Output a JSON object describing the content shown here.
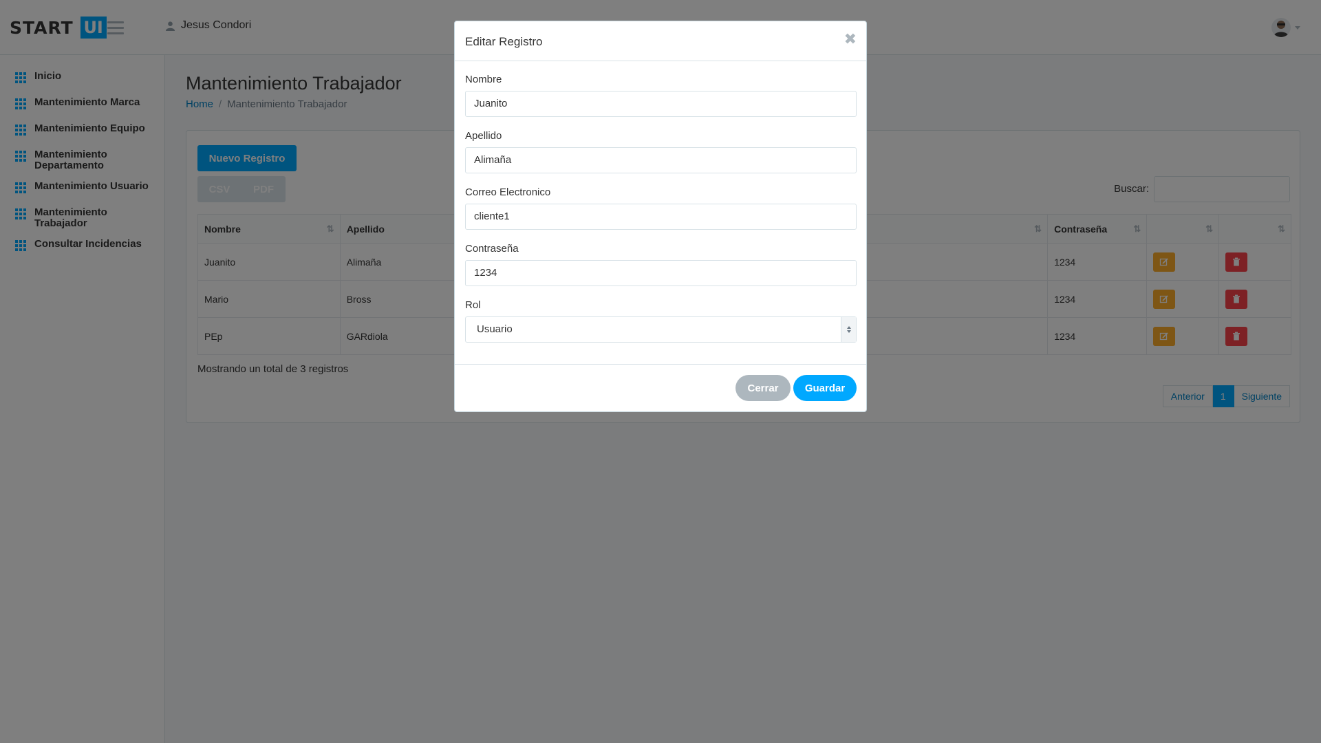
{
  "header": {
    "logo_start": "START",
    "logo_ui": "UI",
    "user_name": "Jesus Condori"
  },
  "sidebar": {
    "items": [
      {
        "label": "Inicio"
      },
      {
        "label": "Mantenimiento Marca"
      },
      {
        "label": "Mantenimiento Equipo"
      },
      {
        "label": "Mantenimiento Departamento"
      },
      {
        "label": "Mantenimiento Usuario"
      },
      {
        "label": "Mantenimiento Trabajador"
      },
      {
        "label": "Consultar Incidencias"
      }
    ]
  },
  "page": {
    "title": "Mantenimiento Trabajador",
    "breadcrumb_home": "Home",
    "breadcrumb_sep": "/",
    "breadcrumb_current": "Mantenimiento Trabajador"
  },
  "toolbar": {
    "new_label": "Nuevo Registro",
    "csv_label": "CSV",
    "pdf_label": "PDF",
    "search_label": "Buscar:"
  },
  "table": {
    "headers": [
      "Nombre",
      "Apellido",
      "",
      "Contraseña",
      "",
      ""
    ],
    "rows": [
      {
        "nombre": "Juanito",
        "apellido": "Alimaña",
        "contrasena": "1234"
      },
      {
        "nombre": "Mario",
        "apellido": "Bross",
        "contrasena": "1234"
      },
      {
        "nombre": "PEp",
        "apellido": "GARdiola",
        "contrasena": "1234"
      }
    ]
  },
  "footer": {
    "total_text": "Mostrando un total de 3 registros",
    "prev_label": "Anterior",
    "page_label": "1",
    "next_label": "Siguiente"
  },
  "modal": {
    "title": "Editar Registro",
    "close_glyph": "✖",
    "fields": {
      "nombre": {
        "label": "Nombre",
        "value": "Juanito"
      },
      "apellido": {
        "label": "Apellido",
        "value": "Alimaña"
      },
      "correo": {
        "label": "Correo Electronico",
        "value": "cliente1"
      },
      "contrasena": {
        "label": "Contraseña",
        "value": "1234"
      },
      "rol": {
        "label": "Rol",
        "value": "Usuario"
      }
    },
    "cerrar_label": "Cerrar",
    "guardar_label": "Guardar"
  },
  "colors": {
    "accent": "#00a8ff",
    "edit": "#fdad2a",
    "delete": "#fa424a"
  },
  "icons": [
    "user-icon",
    "menu-icon",
    "grid-icon",
    "sort-icon",
    "edit-icon",
    "trash-icon",
    "close-icon",
    "avatar-icon"
  ]
}
